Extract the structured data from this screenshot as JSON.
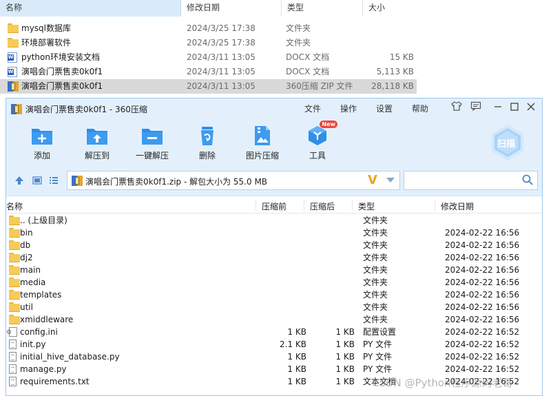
{
  "explorer": {
    "columns": {
      "name": "名称",
      "date": "修改日期",
      "type": "类型",
      "size": "大小"
    },
    "rows": [
      {
        "icon": "folder-icon",
        "name": "mysql数据库",
        "date": "2024/3/25 17:38",
        "type": "文件夹",
        "size": ""
      },
      {
        "icon": "folder-icon",
        "name": "环境部署软件",
        "date": "2024/3/25 17:38",
        "type": "文件夹",
        "size": ""
      },
      {
        "icon": "word-doc-icon",
        "name": "python环境安装文档",
        "date": "2024/3/11 13:05",
        "type": "DOCX 文档",
        "size": "15 KB"
      },
      {
        "icon": "word-doc-icon",
        "name": "演唱会门票售卖0k0f1",
        "date": "2024/3/11 13:05",
        "type": "DOCX 文档",
        "size": "5,113 KB"
      },
      {
        "icon": "zip-archive-icon",
        "name": "演唱会门票售卖0k0f1",
        "date": "2024/3/11 13:05",
        "type": "360压缩 ZIP 文件",
        "size": "28,118 KB"
      }
    ]
  },
  "zip": {
    "title": "演唱会门票售卖0k0f1 - 360压缩",
    "menu": {
      "file": "文件",
      "operate": "操作",
      "settings": "设置",
      "help": "帮助"
    },
    "tools": {
      "add": "添加",
      "extract_to": "解压到",
      "one_click": "一键解压",
      "delete": "删除",
      "image_compress": "图片压缩",
      "tools": "工具",
      "new_badge": "New",
      "scan": "扫描"
    },
    "address": "演唱会门票售卖0k0f1.zip - 解包大小为 55.0 MB",
    "address_logo": "V",
    "search_placeholder": "",
    "columns": {
      "name": "名称",
      "before": "压缩前",
      "after": "压缩后",
      "type": "类型",
      "date": "修改日期"
    },
    "files": [
      {
        "icon": "folder-icon",
        "name": ".. (上级目录)",
        "before": "",
        "after": "",
        "type": "文件夹",
        "date": ""
      },
      {
        "icon": "folder-icon",
        "name": "bin",
        "before": "",
        "after": "",
        "type": "文件夹",
        "date": "2024-02-22 16:56"
      },
      {
        "icon": "folder-icon",
        "name": "db",
        "before": "",
        "after": "",
        "type": "文件夹",
        "date": "2024-02-22 16:56"
      },
      {
        "icon": "folder-icon",
        "name": "dj2",
        "before": "",
        "after": "",
        "type": "文件夹",
        "date": "2024-02-22 16:56"
      },
      {
        "icon": "folder-icon",
        "name": "main",
        "before": "",
        "after": "",
        "type": "文件夹",
        "date": "2024-02-22 16:56"
      },
      {
        "icon": "folder-icon",
        "name": "media",
        "before": "",
        "after": "",
        "type": "文件夹",
        "date": "2024-02-22 16:56"
      },
      {
        "icon": "folder-icon",
        "name": "templates",
        "before": "",
        "after": "",
        "type": "文件夹",
        "date": "2024-02-22 16:56"
      },
      {
        "icon": "folder-icon",
        "name": "util",
        "before": "",
        "after": "",
        "type": "文件夹",
        "date": "2024-02-22 16:56"
      },
      {
        "icon": "folder-icon",
        "name": "xmiddleware",
        "before": "",
        "after": "",
        "type": "文件夹",
        "date": "2024-02-22 16:56"
      },
      {
        "icon": "config-file-icon",
        "name": "config.ini",
        "before": "1 KB",
        "after": "1 KB",
        "type": "配置设置",
        "date": "2024-02-22 16:52"
      },
      {
        "icon": "file-icon",
        "name": "init.py",
        "before": "2.1 KB",
        "after": "1 KB",
        "type": "PY 文件",
        "date": "2024-02-22 16:52"
      },
      {
        "icon": "file-icon",
        "name": "initial_hive_database.py",
        "before": "1 KB",
        "after": "1 KB",
        "type": "PY 文件",
        "date": "2024-02-22 16:52"
      },
      {
        "icon": "file-icon",
        "name": "manage.py",
        "before": "1 KB",
        "after": "1 KB",
        "type": "PY 文件",
        "date": "2024-02-22 16:52"
      },
      {
        "icon": "file-icon",
        "name": "requirements.txt",
        "before": "1 KB",
        "after": "1 KB",
        "type": "文本文档",
        "date": "2024-02-22 16:52"
      }
    ]
  },
  "watermark": "CSDN @Python程序源码老哥",
  "colors": {
    "zip_chrome": "#e3f0fc",
    "zip_blue": "#2f8fe6",
    "selected_row": "#d9d9d9",
    "header_highlight": "#d9ebf9"
  }
}
